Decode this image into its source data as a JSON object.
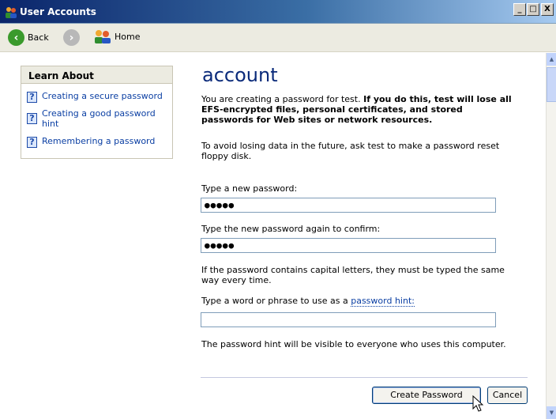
{
  "window": {
    "title": "User Accounts"
  },
  "title_buttons": {
    "minimize": "_",
    "maximize": "□",
    "close": "X"
  },
  "navbar": {
    "back_label": "Back",
    "home_label": "Home"
  },
  "learn_about": {
    "header": "Learn About",
    "items": [
      {
        "line1": "Creating a secure password",
        "line2": ""
      },
      {
        "line1": "Creating a good password",
        "line2": "hint"
      },
      {
        "line1": "Remembering a password",
        "line2": ""
      }
    ]
  },
  "main": {
    "heading": "account",
    "intro_plain": "You are creating a password for test. ",
    "intro_bold": "If you do this, test will lose all EFS-encrypted files, personal certificates, and stored passwords for Web sites or network resources.",
    "reset_note": "To avoid losing data in the future, ask test to make a password reset floppy disk.",
    "new_password_label": "Type a new password:",
    "new_password_value": "●●●●●",
    "confirm_label": "Type the new password again to confirm:",
    "confirm_value": "●●●●●",
    "capital_note": "If the password contains capital letters, they must be typed the same way every time.",
    "hint_label_prefix": "Type a word or phrase to use as a ",
    "hint_label_link": "password hint:",
    "hint_value": "",
    "hint_visibility_note": "The password hint will be visible to everyone who uses this computer."
  },
  "buttons": {
    "create": "Create Password",
    "cancel": "Cancel"
  },
  "colors": {
    "titlebar": "#0a246a",
    "link": "#0b3fa3",
    "heading": "#0a2a7a",
    "back_button": "#3a9a2c",
    "forward_button": "#b8b8b8"
  }
}
